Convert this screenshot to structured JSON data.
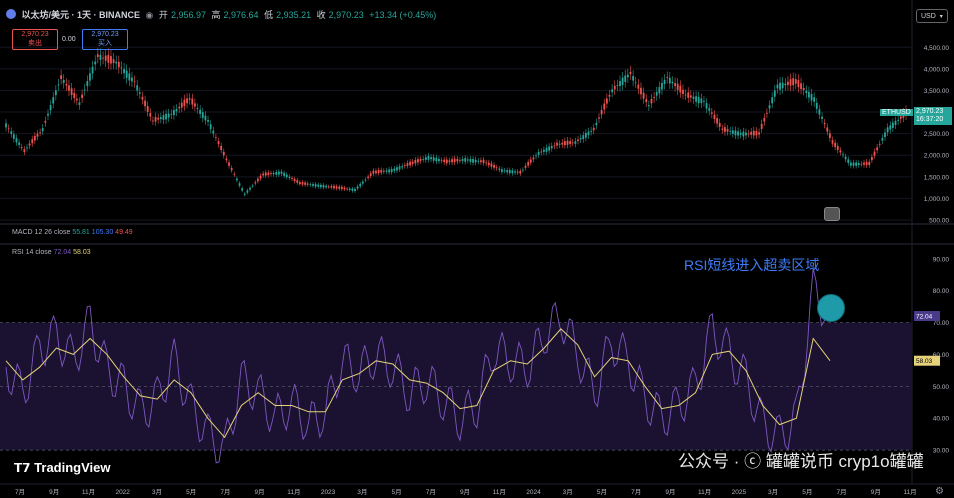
{
  "header": {
    "symbol": "以太坊/美元 · 1天 · BINANCE",
    "open_label": "开",
    "open_value": "2,956.97",
    "high_label": "高",
    "high_value": "2,976.64",
    "low_label": "低",
    "low_value": "2,935.21",
    "close_label": "收",
    "close_value": "2,970.23",
    "change": "+13.34 (+0.45%)",
    "sell_price": "2,970.23",
    "sell_label": "卖出",
    "spread": "0.00",
    "buy_price": "2,970.23",
    "buy_label": "买入",
    "currency": "USD"
  },
  "price_tag": {
    "symbol": "ETHUSD",
    "price": "2,970.23",
    "countdown": "16:37:20"
  },
  "macd_legend": {
    "label": "MACD 12 26 close",
    "v1": "55.81",
    "v2": "105.30",
    "v3": "49.49"
  },
  "rsi_legend": {
    "label": "RSI 14 close",
    "v1": "72.04",
    "v2": "58.03"
  },
  "annotation": "RSI短线进入超卖区域",
  "branding": {
    "tradingview": "TradingView",
    "watermark": "公众号 · ⓒ 罐罐说币 cryp1o罐罐"
  },
  "x_axis_labels": [
    "7月",
    "9月",
    "11月",
    "2022",
    "3月",
    "5月",
    "7月",
    "9月",
    "11月",
    "2023",
    "3月",
    "5月",
    "7月",
    "9月",
    "11月",
    "2024",
    "3月",
    "5月",
    "7月",
    "9月",
    "11月",
    "2025",
    "3月",
    "5月",
    "7月",
    "9月",
    "11月"
  ],
  "colors": {
    "up": "#26a69a",
    "down": "#ef5350",
    "rsi_line": "#7e57c2",
    "rsi_ma": "#e6d27a",
    "annotation": "#3e7cf7",
    "marker": "#1f9aa8",
    "background": "#000000"
  },
  "chart_data": [
    {
      "type": "candlestick",
      "title": "以太坊/美元 · 1天 · BINANCE",
      "y_ticks": [
        500,
        1000,
        1500,
        2000,
        2500,
        3000,
        3500,
        4000,
        4500
      ],
      "y_tick_labels": [
        "500.00",
        "1,000.00",
        "1,500.00",
        "2,000.00",
        "2,500.00",
        "3,000.00",
        "3,500.00",
        "4,000.00",
        "4,500.00"
      ],
      "ylim": [
        500,
        4900
      ],
      "x": [
        "2021-06",
        "2021-07",
        "2021-08",
        "2021-09",
        "2021-10",
        "2021-11",
        "2021-12",
        "2022-01",
        "2022-02",
        "2022-03",
        "2022-04",
        "2022-05",
        "2022-06",
        "2022-07",
        "2022-08",
        "2022-09",
        "2022-10",
        "2022-11",
        "2022-12",
        "2023-01",
        "2023-02",
        "2023-03",
        "2023-04",
        "2023-05",
        "2023-06",
        "2023-07",
        "2023-08",
        "2023-09",
        "2023-10",
        "2023-11",
        "2023-12",
        "2024-01",
        "2024-02",
        "2024-03",
        "2024-04",
        "2024-05",
        "2024-06",
        "2024-07",
        "2024-08",
        "2024-09",
        "2024-10",
        "2024-11",
        "2024-12",
        "2025-01",
        "2025-02",
        "2025-03",
        "2025-04",
        "2025-05",
        "2025-06",
        "2025-07"
      ],
      "close": [
        2700,
        2100,
        2600,
        3800,
        3200,
        4300,
        4150,
        3700,
        2800,
        2950,
        3300,
        2800,
        1900,
        1100,
        1550,
        1600,
        1350,
        1300,
        1250,
        1200,
        1600,
        1650,
        1800,
        1950,
        1850,
        1900,
        1850,
        1650,
        1600,
        2050,
        2250,
        2300,
        2600,
        3500,
        3900,
        3150,
        3800,
        3400,
        3250,
        2600,
        2500,
        2500,
        3600,
        3700,
        3300,
        2300,
        1800,
        1800,
        2600,
        2970
      ]
    },
    {
      "type": "line",
      "title": "RSI 14 close",
      "series": [
        {
          "name": "RSI",
          "values": [
            56,
            48,
            62,
            66,
            58,
            70,
            55,
            50,
            42,
            46,
            58,
            44,
            35,
            30,
            52,
            48,
            40,
            45,
            38,
            42,
            58,
            54,
            60,
            56,
            48,
            52,
            46,
            40,
            44,
            62,
            58,
            56,
            66,
            72,
            60,
            48,
            64,
            58,
            46,
            40,
            44,
            50,
            68,
            60,
            52,
            38,
            34,
            40,
            80,
            72.04
          ]
        },
        {
          "name": "MA",
          "values": [
            58,
            52,
            56,
            62,
            60,
            65,
            60,
            53,
            47,
            46,
            52,
            48,
            40,
            34,
            44,
            48,
            44,
            44,
            42,
            42,
            52,
            54,
            58,
            57,
            52,
            51,
            48,
            43,
            44,
            55,
            58,
            57,
            62,
            68,
            63,
            53,
            59,
            58,
            50,
            43,
            44,
            48,
            60,
            61,
            55,
            44,
            38,
            40,
            65,
            58.03
          ]
        }
      ],
      "y_ticks": [
        30,
        40,
        50,
        60,
        70,
        80,
        90
      ],
      "y_tick_labels": [
        "30.00",
        "40.00",
        "50.00",
        "60.00",
        "70.00",
        "80.00",
        "90.00"
      ],
      "ylim": [
        20,
        94
      ],
      "bands": [
        30,
        50,
        70
      ]
    }
  ]
}
